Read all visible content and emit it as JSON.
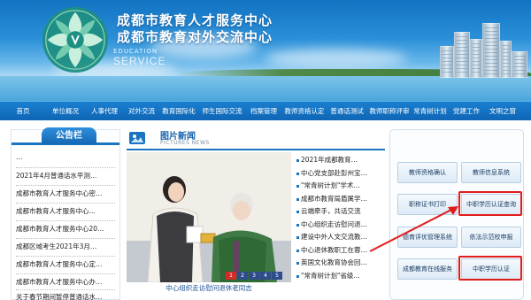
{
  "header": {
    "title_line1": "成都市教育人才服务中心",
    "title_line2": "成都市教育对外交流中心",
    "en_line1": "EDUCATION",
    "en_line2": "SERVICE"
  },
  "nav": {
    "items": [
      "首页",
      "单位概况",
      "人事代理",
      "对外交流",
      "教育国际化",
      "师生国际交流",
      "档案管理",
      "教师资格认定",
      "普通话测试",
      "教师职称评审",
      "常青树计划",
      "党建工作",
      "文明之窗"
    ]
  },
  "notice": {
    "title": "公告栏",
    "items": [
      "…",
      "2021年4月普通话水平测…",
      "成都市教育人才服务中心密…",
      "成都市教育人才服务中心…",
      "成都市教育人才服务中心20…",
      "成都区域考生2021年3月…",
      "成都市教育人才服务中心定…",
      "成都市教育人才服务中心办…",
      "关于春节期间暂停普通话水…"
    ]
  },
  "picnews": {
    "title": "图片新闻",
    "subtitle": "PICTURES NEWS",
    "caption": "中心组织走访慰问退休老同志",
    "pages": [
      "1",
      "2",
      "3",
      "4",
      "5"
    ],
    "active_page": "1",
    "items": [
      "2021年成都教育…",
      "中心党支部赴彭州宝…",
      "\"常青树计划\"学术…",
      "成都市教育局盾属学…",
      "云端牵手，共话交流",
      "中心组织走访慰问退…",
      "建设中外人文交流教…",
      "中心退休教职工在蓉…",
      "英国文化教育协会回…",
      "\"常青树计划\"省级…"
    ]
  },
  "quick": {
    "buttons": [
      "教师资格确认",
      "教师信息系统",
      "职称证书打印",
      "中职学历认证查询",
      "德育评优管理系统",
      "依法示范校申报",
      "成都教育在线服务",
      "中职学历认证"
    ],
    "highlighted": [
      "中职学历认证查询",
      "中职学历认证"
    ],
    "highlight_color": "#e21b1b"
  },
  "colors": {
    "nav_bg": "#1a74c2",
    "accent": "#1a74c2"
  }
}
